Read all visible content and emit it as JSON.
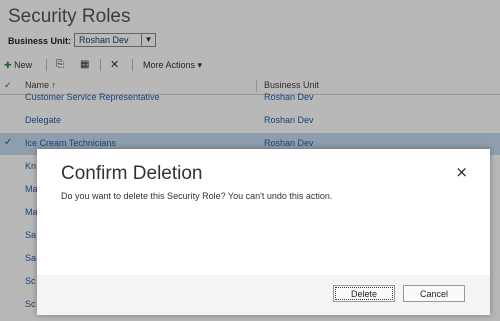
{
  "page": {
    "title": "Security Roles"
  },
  "business_unit": {
    "label": "Business Unit:",
    "value": "Roshan Dev",
    "arrow_icon": "chevron-down-icon"
  },
  "toolbar": {
    "new_label": "New",
    "more_actions_label": "More Actions",
    "more_actions_arrow": "▾"
  },
  "grid": {
    "columns": {
      "check": "✓",
      "name": "Name ↑",
      "business_unit": "Business Unit"
    },
    "rows": [
      {
        "name": "Customer Service Representative",
        "business_unit": "Roshan Dev",
        "selected": false
      },
      {
        "name": "Delegate",
        "business_unit": "Roshan Dev",
        "selected": false
      },
      {
        "name": "Ice Cream Technicians",
        "business_unit": "Roshan Dev",
        "selected": true,
        "check": "✓"
      },
      {
        "name": "Kn",
        "business_unit": "",
        "selected": false
      },
      {
        "name": "Ma",
        "business_unit": "",
        "selected": false
      },
      {
        "name": "Ma",
        "business_unit": "",
        "selected": false
      },
      {
        "name": "Sa",
        "business_unit": "",
        "selected": false
      },
      {
        "name": "Sa",
        "business_unit": "",
        "selected": false
      },
      {
        "name": "Sc",
        "business_unit": "",
        "selected": false
      },
      {
        "name": "Sc",
        "business_unit": "",
        "selected": false
      }
    ]
  },
  "dialog": {
    "title": "Confirm Deletion",
    "close": "×",
    "message": "Do you want to delete this Security Role? You can't undo this action.",
    "delete_label": "Delete",
    "cancel_label": "Cancel"
  }
}
